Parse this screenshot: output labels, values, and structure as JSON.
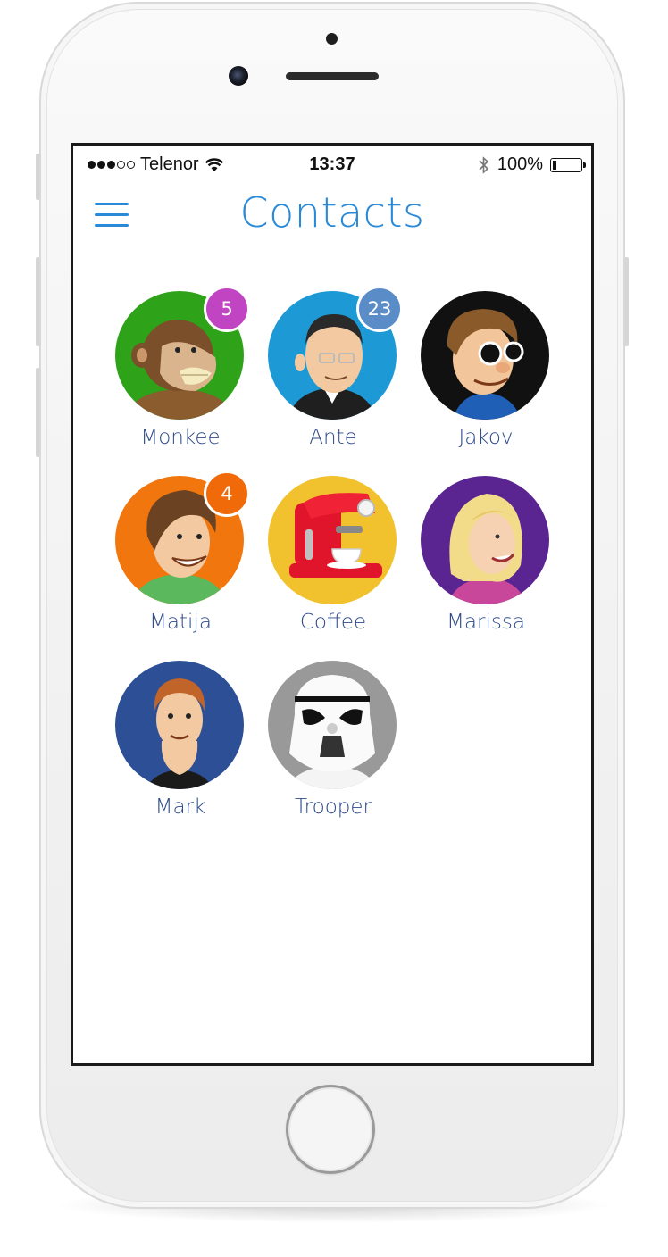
{
  "status_bar": {
    "carrier": "Telenor",
    "time": "13:37",
    "battery": "100%"
  },
  "header": {
    "title": "Contacts"
  },
  "contacts": [
    {
      "name": "Monkee",
      "badge": "5",
      "badge_color": "#c145c2",
      "bg": "#2ea319"
    },
    {
      "name": "Ante",
      "badge": "23",
      "badge_color": "#5a8cc8",
      "bg": "#1d9ad6"
    },
    {
      "name": "Jakov",
      "badge": "",
      "bg": "#111111"
    },
    {
      "name": "Matija",
      "badge": "4",
      "badge_color": "#f06a0a",
      "bg": "#f2760e"
    },
    {
      "name": "Coffee",
      "badge": "",
      "bg": "#f2c22e"
    },
    {
      "name": "Marissa",
      "badge": "",
      "bg": "#5a2591"
    },
    {
      "name": "Mark",
      "badge": "",
      "bg": "#2c4f96"
    },
    {
      "name": "Trooper",
      "badge": "",
      "bg": "#999999"
    }
  ],
  "colors": {
    "accent": "#2a8ad8",
    "name_text": "#2d4a8a"
  }
}
